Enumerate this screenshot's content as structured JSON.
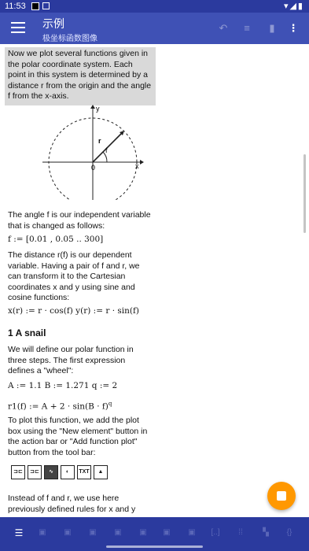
{
  "status": {
    "time": "11:53"
  },
  "appbar": {
    "title": "示例",
    "subtitle": "极坐标函数图像"
  },
  "text": {
    "intro": "Now we plot several functions given in the polar coordinate system. Each point in this system is determined by a distance r from the origin and the angle f from the x-axis.",
    "angle_desc": "The angle f is our independent variable that is changed as follows:",
    "f_def": "f := [0.01 , 0.05 .. 300]",
    "distance_desc": "The distance r(f) is our dependent variable. Having a pair of f and r, we can transform it to the Cartesian coordinates x and y using sine and cosine functions:",
    "xy_def": "x(r) := r · cos(f)   y(r) := r · sin(f)",
    "heading_snail": "1   A snail",
    "snail_desc": "We will define our polar function in three steps. The first expression defines a \"wheel\":",
    "abq_def": "A := 1.1   B := 1.271   q := 2",
    "r1_def": "r1(f) := A + 2 · sin(B · f)",
    "r1_exp": "q",
    "plot_desc": "To plot this function, we add the plot box using the \"New element\" button in the action bar or \"Add function plot\" button from the tool bar:",
    "instead_desc": "Instead of f and r, we use here previously defined rules for x and y"
  },
  "diagram": {
    "y_label": "y",
    "x_label": "x",
    "origin_label": "0",
    "r_label": "r",
    "f_label": "f"
  },
  "tools": [
    {
      "name": "tool-1",
      "label": "⊐⊏"
    },
    {
      "name": "tool-2",
      "label": "⊐⊏"
    },
    {
      "name": "tool-function-plot",
      "label": "∿"
    },
    {
      "name": "tool-4",
      "label": "◐"
    },
    {
      "name": "tool-text",
      "label": "TXT"
    },
    {
      "name": "tool-image",
      "label": "▲"
    }
  ],
  "colors": {
    "appbar": "#3f51b5",
    "statusbar": "#2b3a9e",
    "fab": "#ff9800",
    "highlight": "#d9d9d9"
  }
}
